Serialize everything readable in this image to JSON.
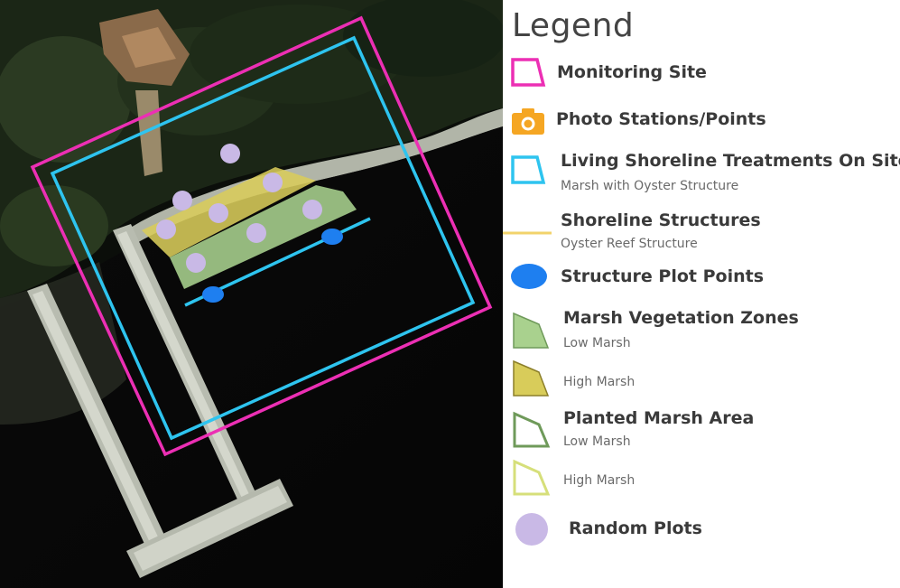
{
  "legend": {
    "title": "Legend",
    "monitoring_site": "Monitoring Site",
    "photo_stations": "Photo Stations/Points",
    "living_shoreline": "Living Shoreline Treatments On Site",
    "living_shoreline_sub": "Marsh with Oyster Structure",
    "shoreline_structures": "Shoreline Structures",
    "shoreline_structures_sub": "Oyster Reef Structure",
    "structure_plot_points": "Structure Plot Points",
    "marsh_vegetation_zones": "Marsh Vegetation Zones",
    "low_marsh_1": "Low Marsh",
    "high_marsh_1": "High Marsh",
    "planted_marsh_area": "Planted Marsh Area",
    "low_marsh_2": "Low Marsh",
    "high_marsh_2": "High Marsh",
    "random_plots": "Random Plots"
  },
  "colors": {
    "monitoring_site": "#ec2fb4",
    "photo_stations": "#f5a623",
    "living_shoreline": "#2ec4ef",
    "shoreline_structures": "#f2d36b",
    "structure_plot_points": "#1e7ff0",
    "low_marsh_fill": "#a9d18e",
    "high_marsh_fill": "#d8cc5a",
    "planted_low_outline": "#6f9a5a",
    "planted_high_outline": "#d6df7a",
    "random_plots": "#c9b9e6"
  },
  "icons": [
    "polygon-icon",
    "camera-icon",
    "line-icon",
    "ellipse-icon",
    "circle-icon"
  ]
}
